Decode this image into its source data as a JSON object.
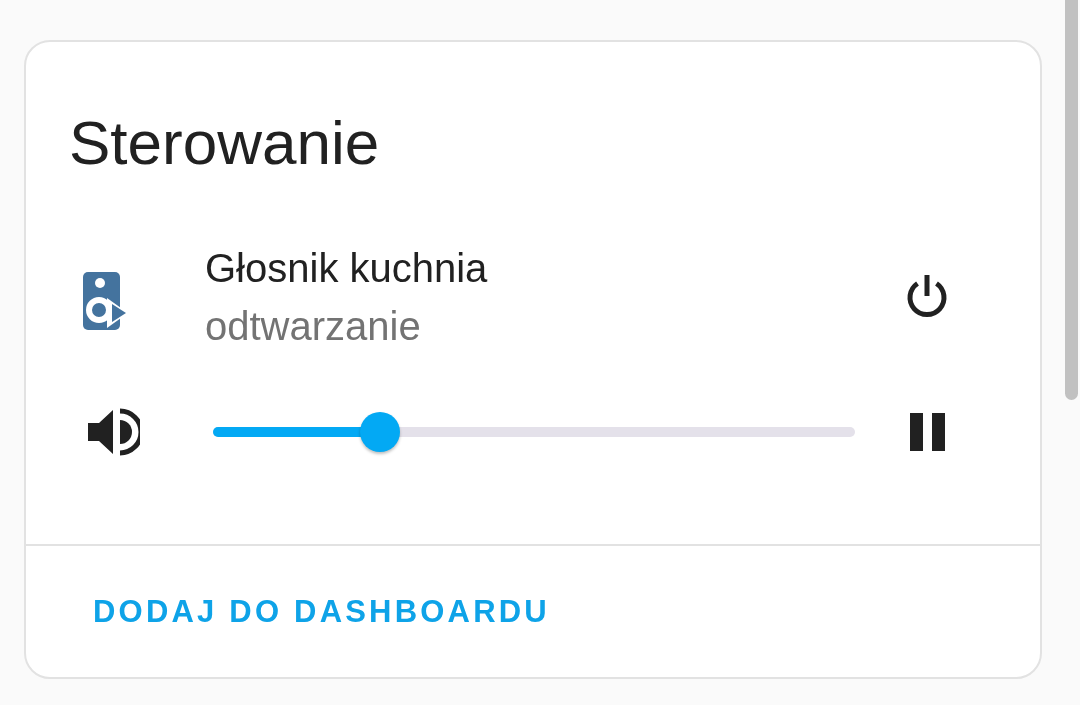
{
  "card": {
    "title": "Sterowanie",
    "entities": [
      {
        "kind": "media_player",
        "name": "Głosnik kuchnia",
        "state": "odtwarzanie",
        "playing": true,
        "volume": {
          "level": 0.26
        }
      }
    ],
    "action": "DODAJ DO DASHBOARDU"
  }
}
